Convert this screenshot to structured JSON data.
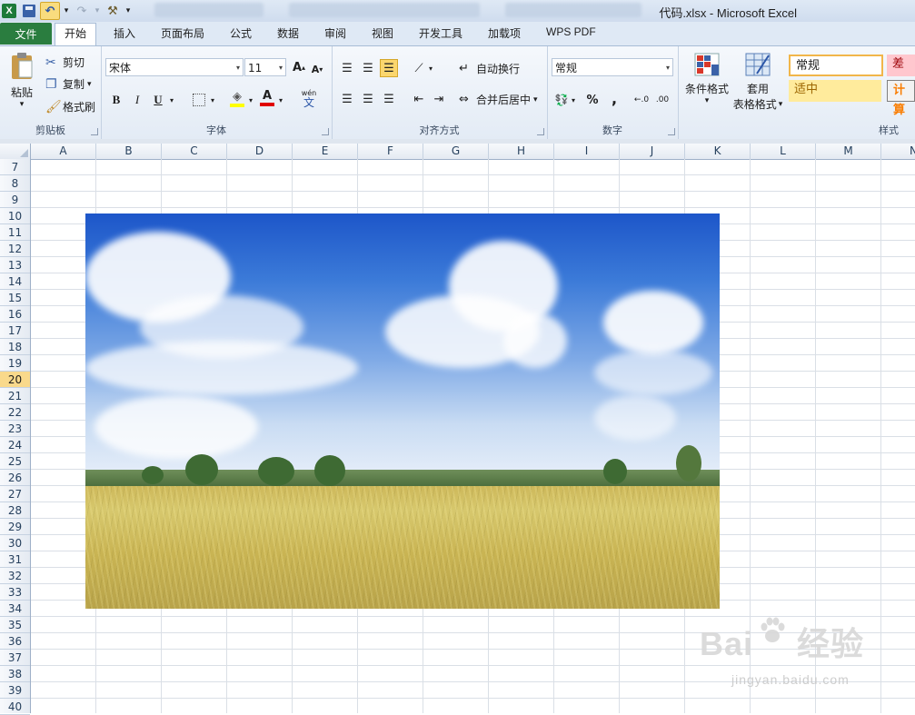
{
  "window": {
    "title": "代码.xlsx - Microsoft Excel"
  },
  "quick_access": {
    "logo_letter": "X",
    "dropdown_glyph": "▾"
  },
  "ribbon_tabs": {
    "file": "文件",
    "items": [
      "开始",
      "插入",
      "页面布局",
      "公式",
      "数据",
      "审阅",
      "视图",
      "开发工具",
      "加载项",
      "WPS PDF"
    ]
  },
  "clipboard": {
    "paste": "粘贴",
    "cut": "剪切",
    "copy": "复制",
    "format_painter": "格式刷",
    "label": "剪贴板"
  },
  "font": {
    "name": "宋体",
    "size": "11",
    "grow": "A",
    "shrink": "A",
    "bold": "B",
    "italic": "I",
    "underline": "U",
    "font_color_letter": "A",
    "phonetic": "wén",
    "label": "字体"
  },
  "alignment": {
    "wrap_text": "自动换行",
    "merge_center": "合并后居中",
    "label": "对齐方式"
  },
  "number": {
    "format": "常规",
    "percent": "%",
    "comma": ",",
    "label": "数字"
  },
  "styles_group": {
    "conditional": "条件格式",
    "table_line1": "套用",
    "table_line2": "表格格式",
    "normal": "常规",
    "bad": "差",
    "neutral": "适中",
    "calc": "计算",
    "label": "样式"
  },
  "columns": [
    "A",
    "B",
    "C",
    "D",
    "E",
    "F",
    "G",
    "H",
    "I",
    "J",
    "K",
    "L",
    "M",
    "N"
  ],
  "rows": [
    "7",
    "8",
    "9",
    "10",
    "11",
    "12",
    "13",
    "14",
    "15",
    "16",
    "17",
    "18",
    "19",
    "20",
    "21",
    "22",
    "23",
    "24",
    "25",
    "26",
    "27",
    "28",
    "29",
    "30",
    "31",
    "32",
    "33",
    "34",
    "35",
    "36",
    "37",
    "38",
    "39",
    "40"
  ],
  "selected_row": "20",
  "watermark": {
    "main": "Bai",
    "main2": "经验",
    "url": "jingyan.baidu.com"
  },
  "colors": {
    "file_tab": "#2a7d3f",
    "selected_row_header": "#f9d98b",
    "style_bad_bg": "#ffc7ce",
    "style_neutral_bg": "#ffeb9c"
  }
}
